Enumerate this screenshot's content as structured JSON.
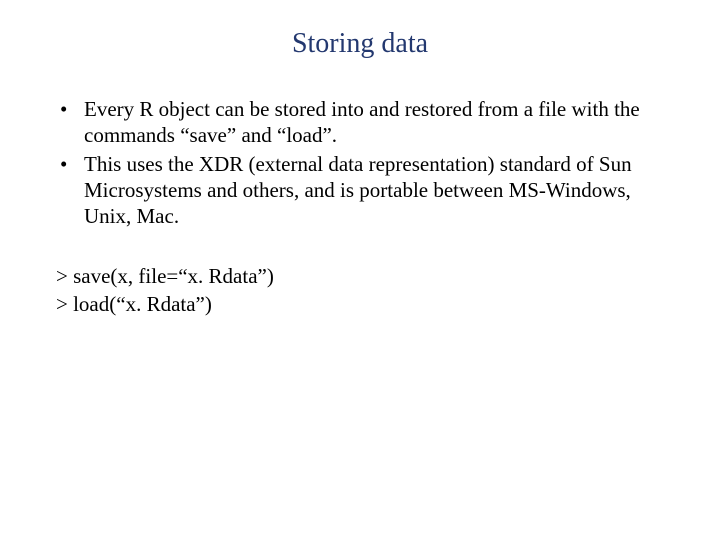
{
  "title": "Storing data",
  "bullets": {
    "item1": "Every R object can be stored into and restored from a file with the commands “save” and “load”.",
    "item2": "This uses the XDR (external data representation) standard of Sun Microsystems and others, and is portable between MS-Windows, Unix, Mac."
  },
  "code": {
    "line1": "> save(x, file=“x. Rdata”)",
    "line2": "> load(“x. Rdata”)"
  }
}
